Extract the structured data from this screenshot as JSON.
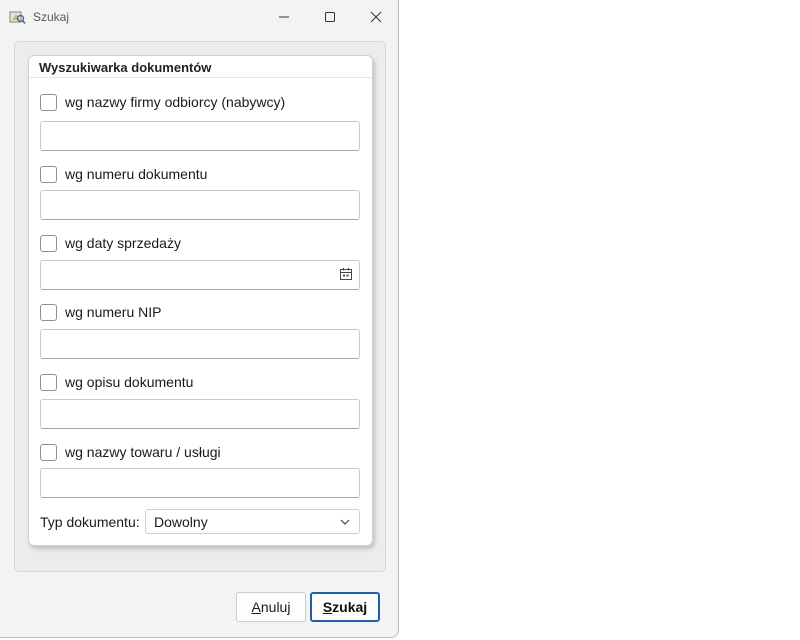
{
  "window": {
    "title": "Szukaj",
    "controls": {
      "minimize_icon": "minimize-icon",
      "maximize_icon": "maximize-icon",
      "close_icon": "close-icon"
    }
  },
  "group": {
    "title": "Wyszukiwarka dokumentów",
    "criteria": [
      {
        "label": "wg nazwy firmy odbiorcy (nabywcy)",
        "checked": false,
        "value": ""
      },
      {
        "label": "wg numeru dokumentu",
        "checked": false,
        "value": ""
      },
      {
        "label": "wg daty sprzedaży",
        "checked": false,
        "value": "",
        "icon": "calendar-icon"
      },
      {
        "label": "wg numeru NIP",
        "checked": false,
        "value": ""
      },
      {
        "label": "wg opisu dokumentu",
        "checked": false,
        "value": ""
      },
      {
        "label": "wg nazwy towaru / usługi",
        "checked": false,
        "value": ""
      }
    ],
    "doc_type": {
      "label": "Typ dokumentu:",
      "value": "Dowolny"
    }
  },
  "buttons": {
    "cancel": {
      "mnemonic": "A",
      "rest": "nuluj"
    },
    "search": {
      "mnemonic": "S",
      "rest": "zukaj"
    }
  },
  "colors": {
    "accent": "#1f5fa8",
    "window_bg": "#f3f3f3",
    "panel_bg": "#ececec"
  }
}
